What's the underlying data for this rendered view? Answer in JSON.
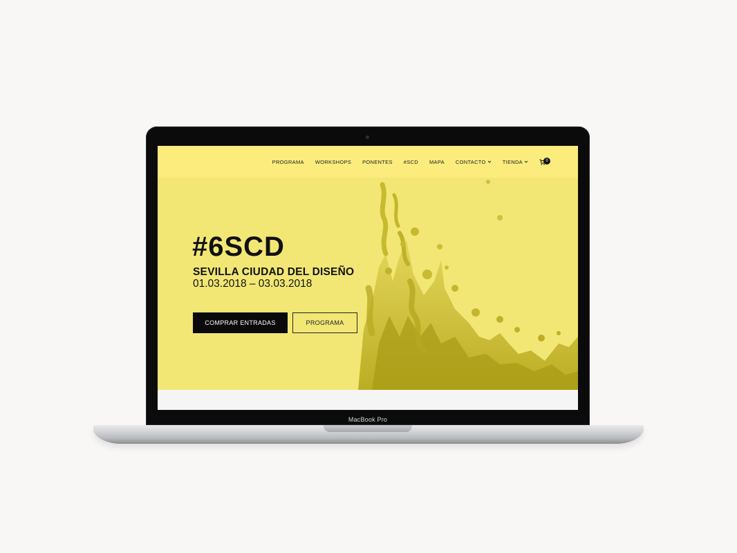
{
  "device": {
    "bezel_label": "MacBook Pro"
  },
  "nav": {
    "items": [
      {
        "label": "PROGRAMA"
      },
      {
        "label": "WORKSHOPS"
      },
      {
        "label": "PONENTES"
      },
      {
        "label": "#SCD"
      },
      {
        "label": "MAPA"
      },
      {
        "label": "CONTACTO"
      },
      {
        "label": "TIENDA"
      }
    ],
    "cart_count": "0",
    "cart_icon": "shopping-cart-icon",
    "dropdown_icon": "chevron-down-icon"
  },
  "hero": {
    "title": "#6SCD",
    "subtitle": "SEVILLA CIUDAD DEL DISEÑO",
    "dates": "01.03.2018 – 03.03.2018",
    "buy_button": "COMPRAR ENTRADAS",
    "program_button": "PROGRAMA",
    "background_color": "#f2e775",
    "navbar_color": "#fbec7d"
  }
}
